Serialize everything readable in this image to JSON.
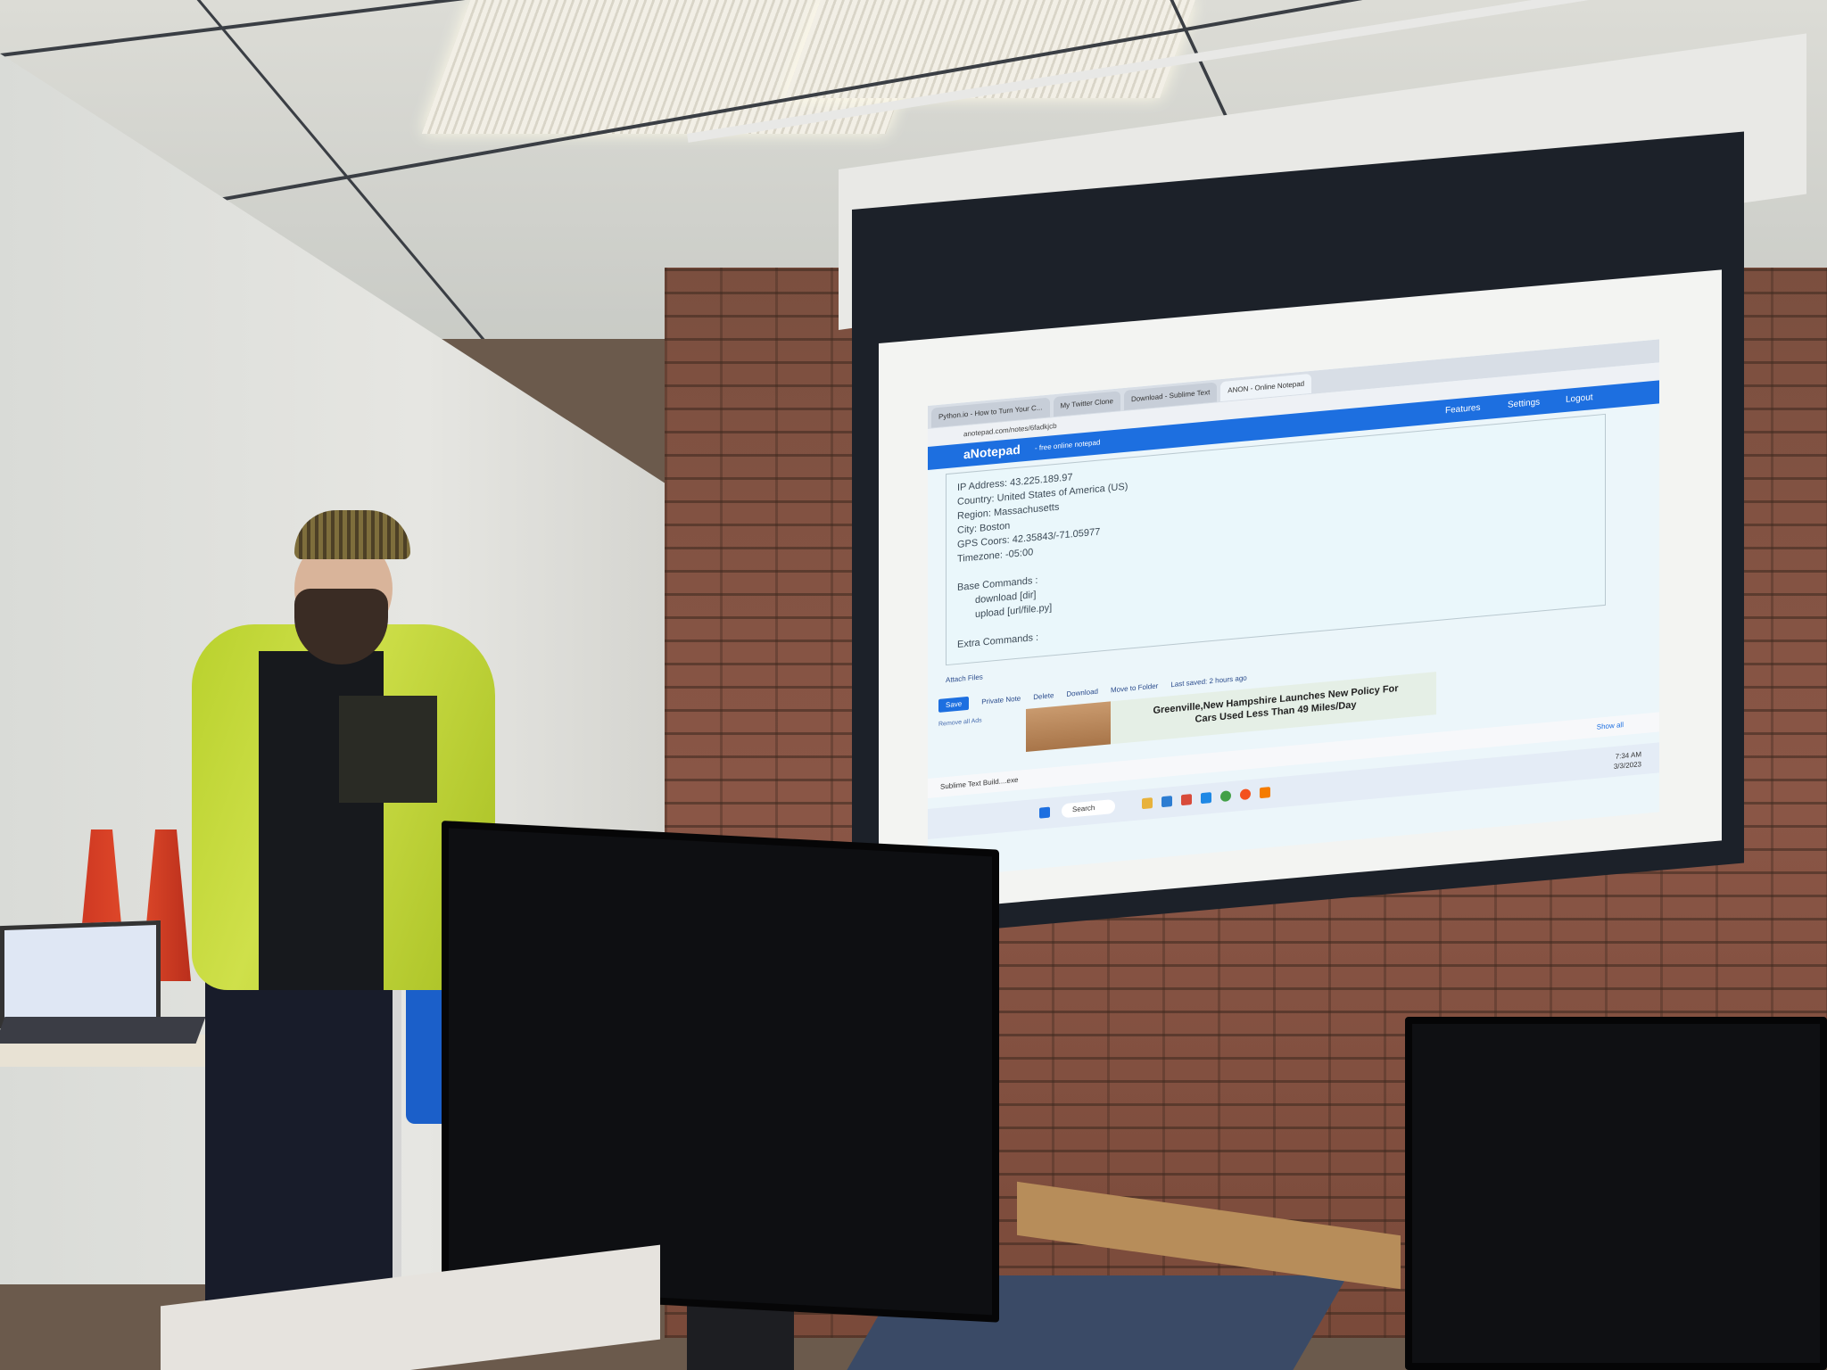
{
  "scene": {
    "description_colors": {
      "brick": "#8a5646",
      "jacket": "#c1d62f",
      "ceiling": "#d6d7d2",
      "app_accent": "#1d6fe0"
    }
  },
  "browser": {
    "tabs": [
      "Python.io - How to Turn Your C...",
      "My Twitter Clone",
      "Download - Sublime Text",
      "ANON - Online Notepad"
    ],
    "address": "anotepad.com/notes/6fadkjcb"
  },
  "app": {
    "logo": "aNotepad",
    "tagline": "- free online notepad",
    "nav": [
      "Features",
      "Settings",
      "Logout"
    ]
  },
  "note": {
    "lines": [
      "IP Address: 43.225.189.97",
      "Country: United States of America (US)",
      "Region: Massachusetts",
      "City: Boston",
      "GPS Coors: 42.35843/-71.05977",
      "Timezone: -05:00",
      "",
      "Base Commands :",
      "download [dir]",
      "upload [url/file.py]",
      "",
      "Extra Commands :"
    ]
  },
  "actions": {
    "attach": "Attach Files",
    "save": "Save",
    "private": "Private Note",
    "delete": "Delete",
    "download": "Download",
    "move": "Move to Folder",
    "last_saved": "Last saved: 2 hours ago",
    "remove_ads": "Remove all Ads"
  },
  "ad": {
    "headline": "Greenville,New Hampshire Launches New Policy For Cars Used Less Than 49 Miles/Day"
  },
  "downloads": {
    "item": "Sublime Text Build....exe",
    "show_all": "Show all"
  },
  "taskbar": {
    "search": "Search",
    "time": "7:34 AM",
    "date": "3/3/2023"
  }
}
